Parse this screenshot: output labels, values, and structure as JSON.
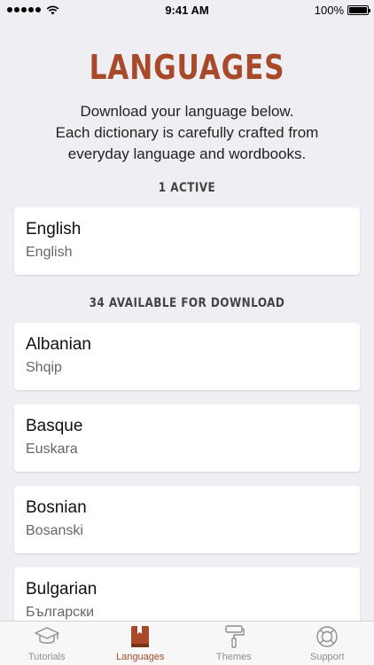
{
  "status_bar": {
    "time": "9:41 AM",
    "battery": "100%",
    "battery_level": 1.0
  },
  "header": {
    "title": "LANGUAGES",
    "intro_lines": [
      "Download your language below.",
      "Each dictionary is carefully crafted from",
      "everyday language and wordbooks."
    ]
  },
  "active_section": {
    "header": "1 ACTIVE",
    "items": [
      {
        "name": "English",
        "native": "English"
      }
    ]
  },
  "available_section": {
    "header": "34 AVAILABLE FOR DOWNLOAD",
    "items": [
      {
        "name": "Albanian",
        "native": "Shqip"
      },
      {
        "name": "Basque",
        "native": "Euskara"
      },
      {
        "name": "Bosnian",
        "native": "Bosanski"
      },
      {
        "name": "Bulgarian",
        "native": "Български"
      }
    ]
  },
  "tab_bar": {
    "tabs": [
      {
        "label": "Tutorials",
        "icon": "graduation-cap-icon"
      },
      {
        "label": "Languages",
        "icon": "book-icon",
        "active": true
      },
      {
        "label": "Themes",
        "icon": "paint-roller-icon"
      },
      {
        "label": "Support",
        "icon": "lifebuoy-icon"
      }
    ]
  },
  "colors": {
    "accent": "#a84a2a",
    "background": "#efeef3",
    "inactive": "#8e8e93"
  }
}
